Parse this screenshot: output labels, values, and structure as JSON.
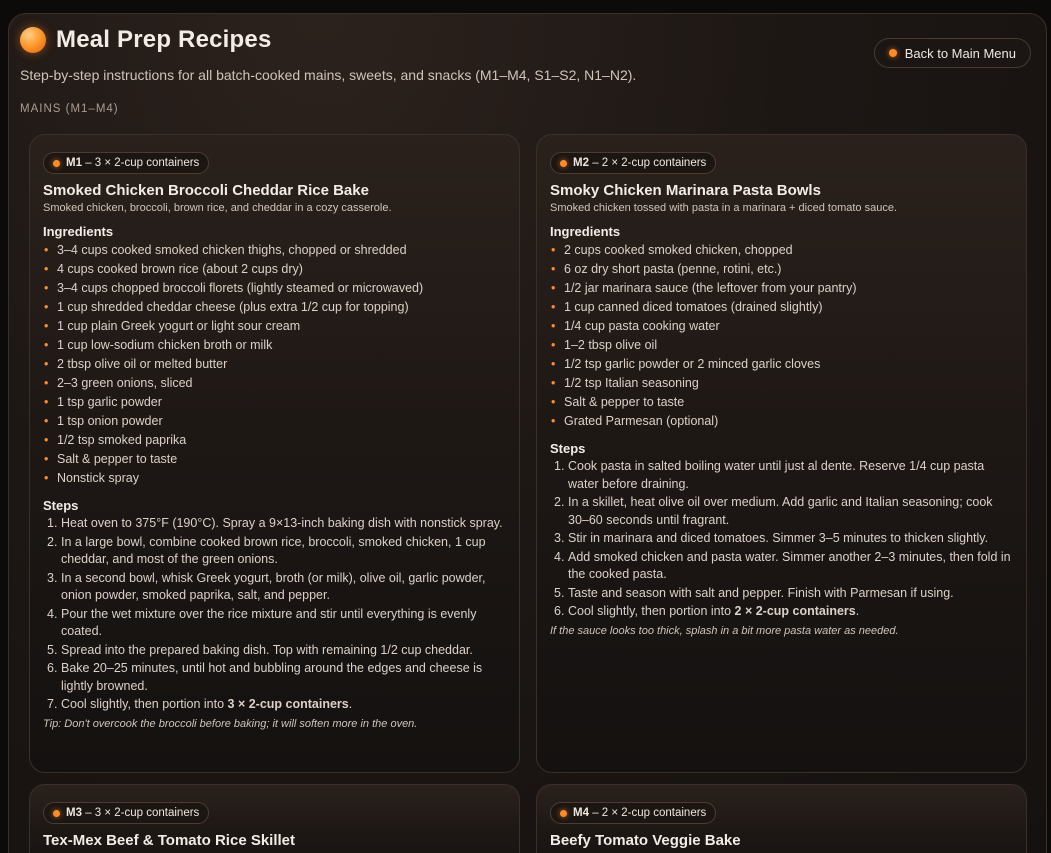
{
  "header": {
    "title": "Meal Prep Recipes",
    "subtitle": "Step-by-step instructions for all batch-cooked mains, sweets, and snacks (M1–M4, S1–S2, N1–N2).",
    "back_label": "Back to Main Menu"
  },
  "section_label": "MAINS (M1–M4)",
  "colors": {
    "accent": "#ff8c26",
    "background": "#141110",
    "card_border": "#3a302a"
  },
  "cards": [
    {
      "tag_code": "M1",
      "tag_text": "– 3 × 2-cup containers",
      "title": "Smoked Chicken Broccoli Cheddar Rice Bake",
      "description": "Smoked chicken, broccoli, brown rice, and cheddar in a cozy casserole.",
      "ingredients_label": "Ingredients",
      "ingredients": [
        "3–4 cups cooked smoked chicken thighs, chopped or shredded",
        "4 cups cooked brown rice (about 2 cups dry)",
        "3–4 cups chopped broccoli florets (lightly steamed or microwaved)",
        "1 cup shredded cheddar cheese (plus extra 1/2 cup for topping)",
        "1 cup plain Greek yogurt or light sour cream",
        "1 cup low-sodium chicken broth or milk",
        "2 tbsp olive oil or melted butter",
        "2–3 green onions, sliced",
        "1 tsp garlic powder",
        "1 tsp onion powder",
        "1/2 tsp smoked paprika",
        "Salt & pepper to taste",
        "Nonstick spray"
      ],
      "steps_label": "Steps",
      "steps": [
        {
          "n": "1.",
          "text": "Heat oven to 375°F (190°C). Spray a 9×13-inch baking dish with nonstick spray."
        },
        {
          "n": "2.",
          "text": "In a large bowl, combine cooked brown rice, broccoli, smoked chicken, 1 cup cheddar, and most of the green onions."
        },
        {
          "n": "3.",
          "text": "In a second bowl, whisk Greek yogurt, broth (or milk), olive oil, garlic powder, onion powder, smoked paprika, salt, and pepper."
        },
        {
          "n": "4.",
          "text": "Pour the wet mixture over the rice mixture and stir until everything is evenly coated."
        },
        {
          "n": "5.",
          "text": "Spread into the prepared baking dish. Top with remaining 1/2 cup cheddar."
        },
        {
          "n": "6.",
          "text": "Bake 20–25 minutes, until hot and bubbling around the edges and cheese is lightly browned."
        },
        {
          "n": "7.",
          "text": "Cool slightly, then portion into ",
          "bold": "3 × 2-cup containers",
          "after": "."
        }
      ],
      "note": "Tip: Don't overcook the broccoli before baking; it will soften more in the oven."
    },
    {
      "tag_code": "M2",
      "tag_text": "– 2 × 2-cup containers",
      "title": "Smoky Chicken Marinara Pasta Bowls",
      "description": "Smoked chicken tossed with pasta in a marinara + diced tomato sauce.",
      "ingredients_label": "Ingredients",
      "ingredients": [
        "2 cups cooked smoked chicken, chopped",
        "6 oz dry short pasta (penne, rotini, etc.)",
        "1/2 jar marinara sauce (the leftover from your pantry)",
        "1 cup canned diced tomatoes (drained slightly)",
        "1/4 cup pasta cooking water",
        "1–2 tbsp olive oil",
        "1/2 tsp garlic powder or 2 minced garlic cloves",
        "1/2 tsp Italian seasoning",
        "Salt & pepper to taste",
        "Grated Parmesan (optional)"
      ],
      "steps_label": "Steps",
      "steps": [
        {
          "n": "1.",
          "text": "Cook pasta in salted boiling water until just al dente. Reserve 1/4 cup pasta water before draining."
        },
        {
          "n": "2.",
          "text": "In a skillet, heat olive oil over medium. Add garlic and Italian seasoning; cook 30–60 seconds until fragrant."
        },
        {
          "n": "3.",
          "text": "Stir in marinara and diced tomatoes. Simmer 3–5 minutes to thicken slightly."
        },
        {
          "n": "4.",
          "text": "Add smoked chicken and pasta water. Simmer another 2–3 minutes, then fold in the cooked pasta."
        },
        {
          "n": "5.",
          "text": "Taste and season with salt and pepper. Finish with Parmesan if using."
        },
        {
          "n": "6.",
          "text": "Cool slightly, then portion into ",
          "bold": "2 × 2-cup containers",
          "after": "."
        }
      ],
      "note": "If the sauce looks too thick, splash in a bit more pasta water as needed."
    },
    {
      "tag_code": "M3",
      "tag_text": "– 3 × 2-cup containers",
      "title": "Tex-Mex Beef & Tomato Rice Skillet"
    },
    {
      "tag_code": "M4",
      "tag_text": "– 2 × 2-cup containers",
      "title": "Beefy Tomato Veggie Bake"
    }
  ]
}
